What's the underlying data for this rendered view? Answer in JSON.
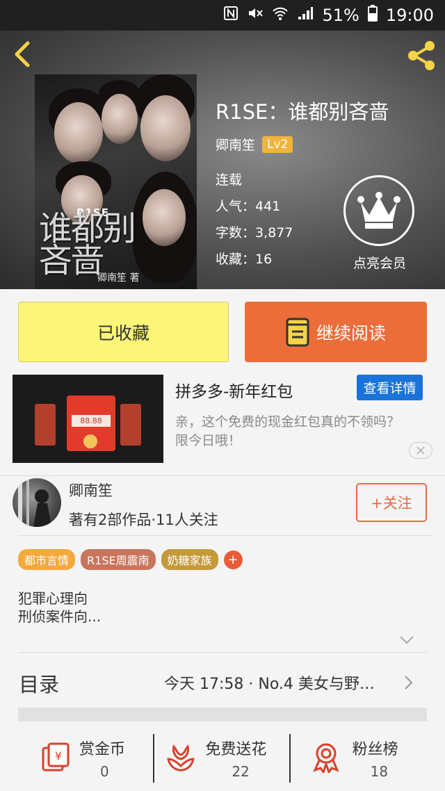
{
  "status_bar": {
    "battery": "51%",
    "time": "19:00"
  },
  "book": {
    "title": "R1SE：谁都别吝啬",
    "author": "卿南笙",
    "level": "Lv2",
    "status": "连载",
    "popularity": "人气：441",
    "word_count": "字数：3,877",
    "favorites": "收藏：16",
    "cover_title": "谁都别吝啬",
    "cover_logo": "R1SE",
    "cover_author": "卿南笙 著"
  },
  "vip": {
    "label": "点亮会员"
  },
  "actions": {
    "collected_label": "已收藏",
    "continue_label": "继续阅读"
  },
  "ad": {
    "title": "拼多多-新年红包",
    "button": "查看详情",
    "description": "亲，这个免费的现金红包真的不领吗？限今日哦！",
    "thumb_amount": "88.88"
  },
  "author_card": {
    "name": "卿南笙",
    "meta": "著有2部作品·11人关注",
    "follow_label": "+关注"
  },
  "tags": [
    {
      "label": "都市言情",
      "color": "#f3a93b"
    },
    {
      "label": "R1SE周震南",
      "color": "#c9745c"
    },
    {
      "label": "奶糖家族",
      "color": "#c49a3a"
    }
  ],
  "tag_add": "+",
  "description": {
    "line1": "犯罪心理向",
    "line2": "刑侦案件向..."
  },
  "toc": {
    "title": "目录",
    "latest": "今天 17:58 · No.4  美女与野…"
  },
  "stats": [
    {
      "label": "赏金币",
      "value": "0",
      "icon": "red-envelope-icon"
    },
    {
      "label": "免费送花",
      "value": "22",
      "icon": "flower-icon"
    },
    {
      "label": "粉丝榜",
      "value": "18",
      "icon": "medal-icon"
    }
  ],
  "colors": {
    "accent_orange": "#ea6d3a",
    "collected_yellow": "#fbf578",
    "ad_blue": "#1a73d9"
  }
}
